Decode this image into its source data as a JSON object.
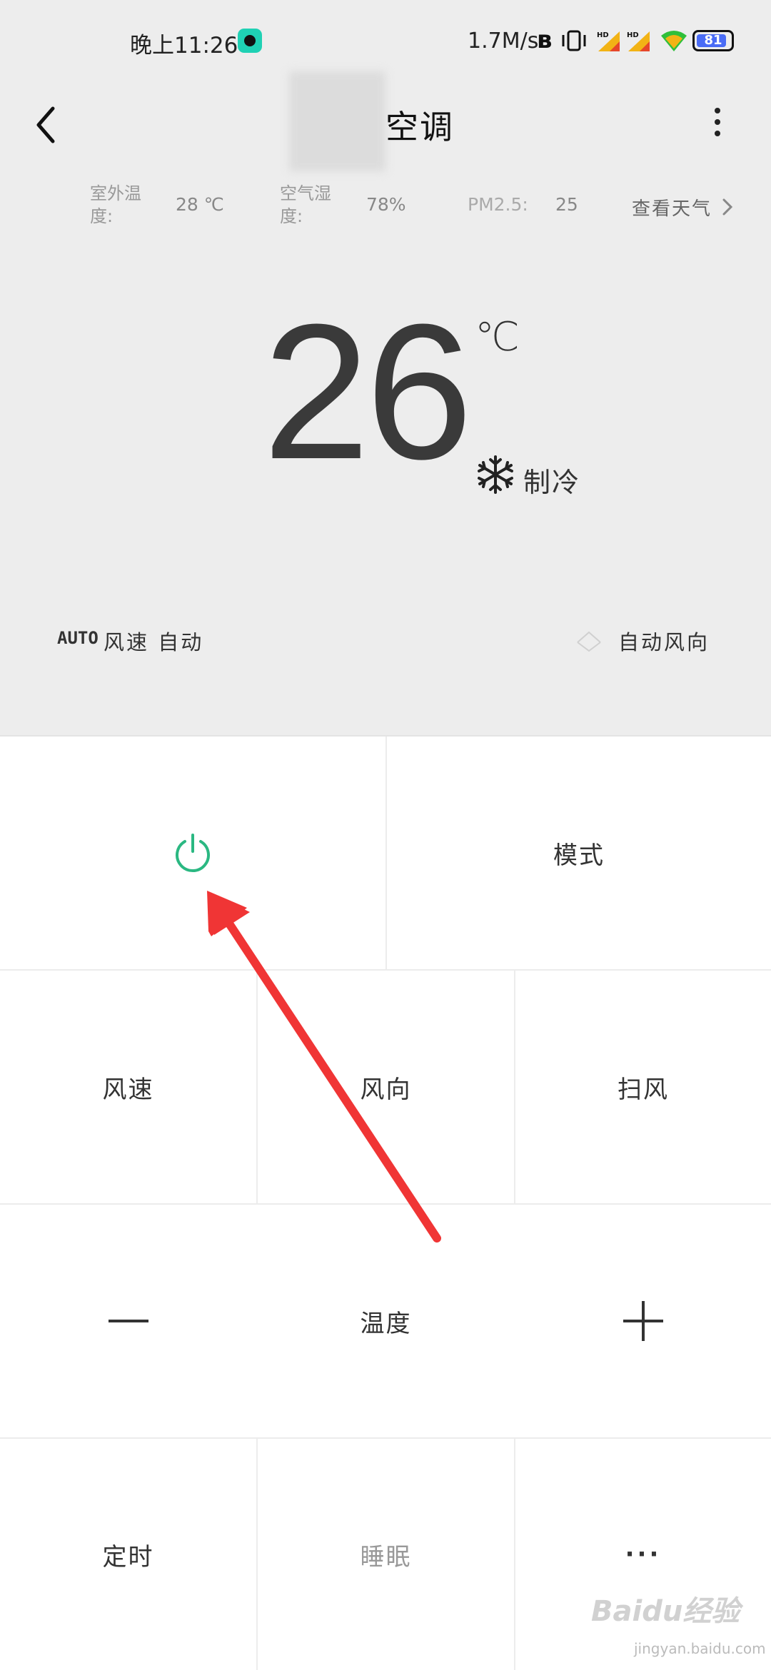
{
  "status_bar": {
    "time": "晚上11:26",
    "net_speed": "1.7M/s",
    "battery": "81",
    "signal_tag": "HD"
  },
  "header": {
    "title": "空调"
  },
  "env": {
    "outdoor_label_1": "室外温",
    "outdoor_label_2": "度:",
    "outdoor_value": "28 ℃",
    "humidity_label_1": "空气湿",
    "humidity_label_2": "度:",
    "humidity_value": "78%",
    "pm_label": "PM2.5:",
    "pm_value": "25",
    "weather_link": "查看天气"
  },
  "display": {
    "temperature": "26",
    "unit": "℃",
    "mode": "制冷"
  },
  "fan": {
    "badge": "AUTO",
    "label": "风速 自动"
  },
  "swing": {
    "label": "自动风向"
  },
  "controls": {
    "mode": "模式",
    "fan_speed": "风速",
    "fan_direction": "风向",
    "sweep": "扫风",
    "minus": "—",
    "temperature": "温度",
    "plus": "+",
    "timer": "定时",
    "sleep": "睡眠",
    "more": "···"
  },
  "colors": {
    "power": "#2bb882",
    "arrow": "#f03535",
    "top_bg": "#ededed"
  },
  "watermark": {
    "logo": "Baidu经验",
    "url": "jingyan.baidu.com"
  }
}
